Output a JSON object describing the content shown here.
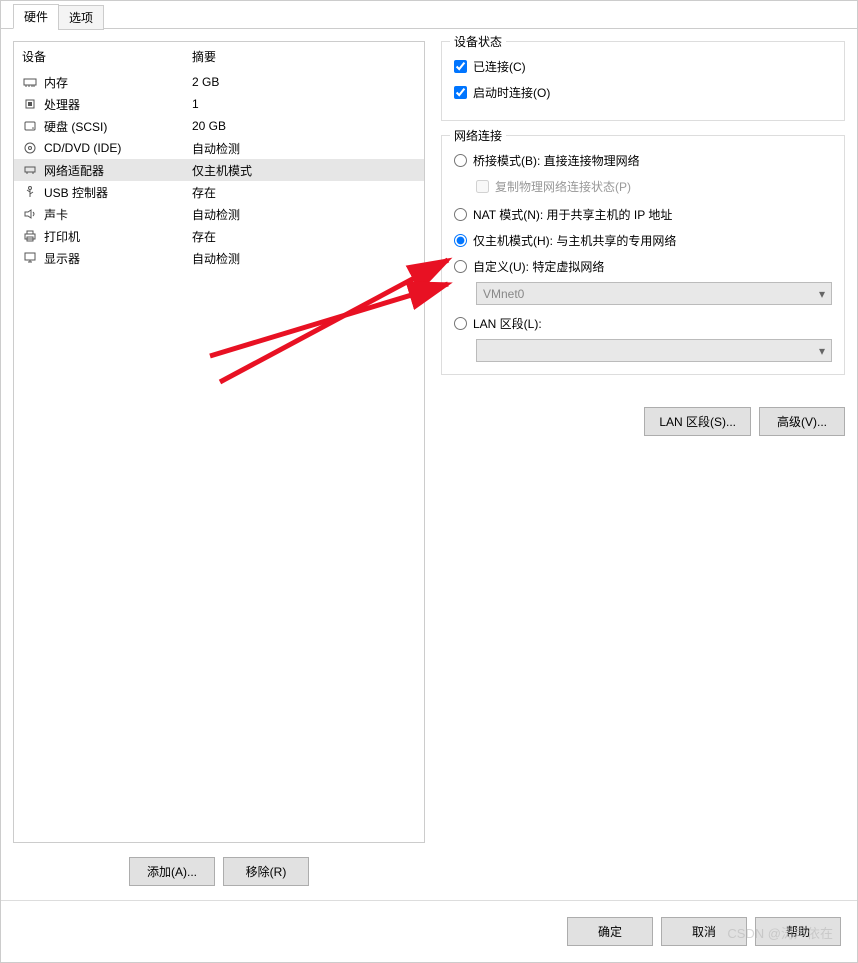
{
  "tabs": {
    "hardware": "硬件",
    "options": "选项"
  },
  "cols": {
    "device": "设备",
    "summary": "摘要"
  },
  "devices": [
    {
      "name": "内存",
      "summary": "2 GB",
      "icon": "memory-icon"
    },
    {
      "name": "处理器",
      "summary": "1",
      "icon": "cpu-icon"
    },
    {
      "name": "硬盘 (SCSI)",
      "summary": "20 GB",
      "icon": "disk-icon"
    },
    {
      "name": "CD/DVD (IDE)",
      "summary": "自动检测",
      "icon": "cd-icon"
    },
    {
      "name": "网络适配器",
      "summary": "仅主机模式",
      "icon": "network-icon",
      "selected": true
    },
    {
      "name": "USB 控制器",
      "summary": "存在",
      "icon": "usb-icon"
    },
    {
      "name": "声卡",
      "summary": "自动检测",
      "icon": "sound-icon"
    },
    {
      "name": "打印机",
      "summary": "存在",
      "icon": "printer-icon"
    },
    {
      "name": "显示器",
      "summary": "自动检测",
      "icon": "display-icon"
    }
  ],
  "leftButtons": {
    "add": "添加(A)...",
    "remove": "移除(R)"
  },
  "groups": {
    "status": "设备状态",
    "network": "网络连接"
  },
  "status": {
    "connected": "已连接(C)",
    "connectAtPowerOn": "启动时连接(O)"
  },
  "network": {
    "bridged": "桥接模式(B): 直接连接物理网络",
    "replicate": "复制物理网络连接状态(P)",
    "nat": "NAT 模式(N): 用于共享主机的 IP 地址",
    "hostonly": "仅主机模式(H): 与主机共享的专用网络",
    "custom": "自定义(U): 特定虚拟网络",
    "customVal": "VMnet0",
    "lan": "LAN 区段(L):",
    "lanVal": ""
  },
  "rightButtons": {
    "lanSegments": "LAN 区段(S)...",
    "advanced": "高级(V)..."
  },
  "bottom": {
    "ok": "确定",
    "cancel": "取消",
    "help": "帮助"
  },
  "watermark": "CSDN @涛声依在"
}
